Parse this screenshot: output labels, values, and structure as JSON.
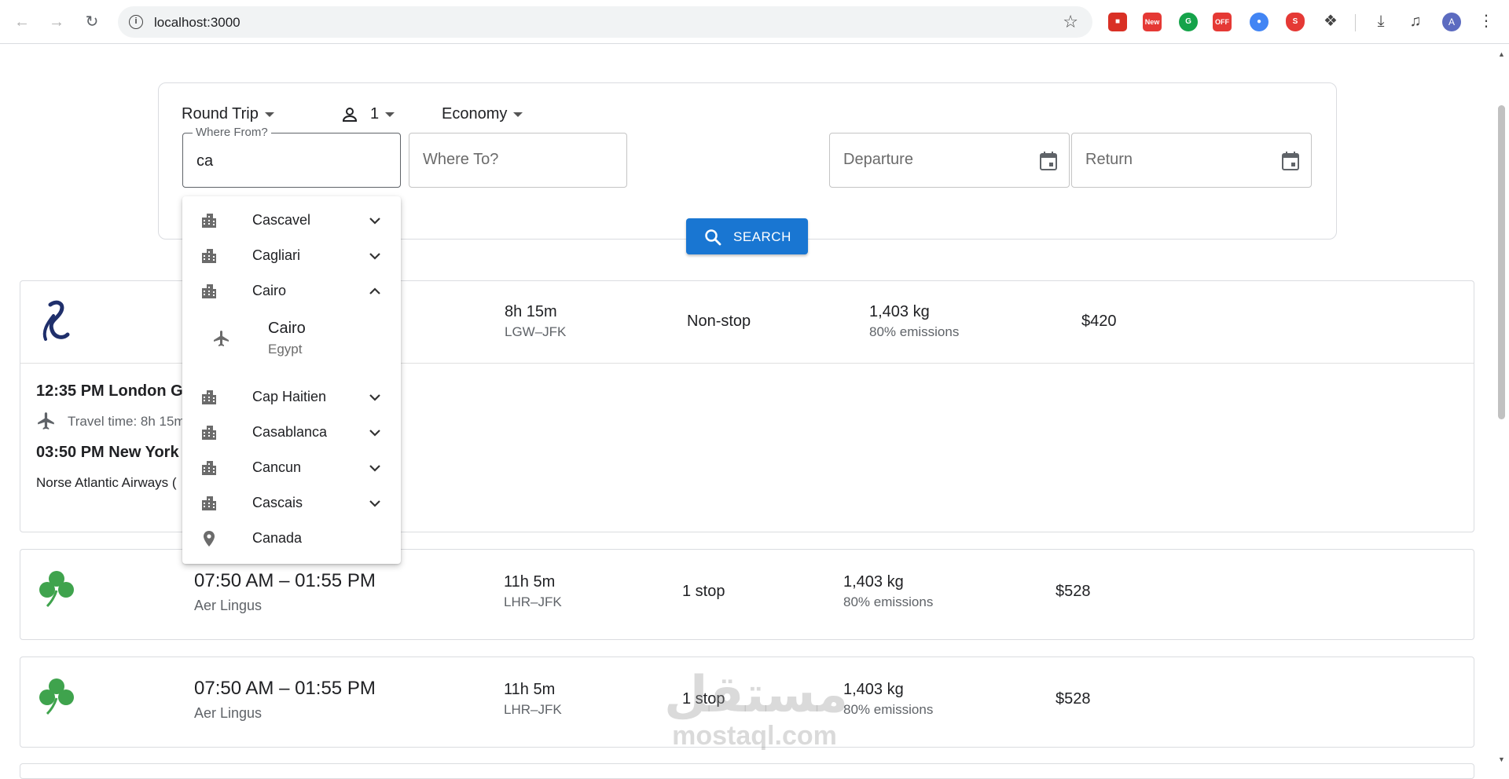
{
  "browser": {
    "url": "localhost:3000",
    "profile_initial": "A",
    "extensions": [
      "extension-1",
      "extension-new",
      "grammarly",
      "extension-off",
      "extension-blue",
      "extension-s",
      "extensions-puzzle"
    ],
    "new_badge": "New",
    "off_badge": "OFF"
  },
  "search": {
    "trip_type": "Round Trip",
    "passengers": "1",
    "cabin_class": "Economy",
    "from_label": "Where From?",
    "from_value": "ca",
    "to_placeholder": "Where To?",
    "departure_placeholder": "Departure",
    "return_placeholder": "Return",
    "search_button": "SEARCH",
    "accent_color": "#1976d2"
  },
  "dropdown": {
    "items": [
      {
        "name": "Cascavel",
        "type": "city",
        "expanded": false
      },
      {
        "name": "Cagliari",
        "type": "city",
        "expanded": false
      },
      {
        "name": "Cairo",
        "type": "city",
        "expanded": true
      },
      {
        "name": "Cap Haitien",
        "type": "city",
        "expanded": false
      },
      {
        "name": "Casablanca",
        "type": "city",
        "expanded": false
      },
      {
        "name": "Cancun",
        "type": "city",
        "expanded": false
      },
      {
        "name": "Cascais",
        "type": "city",
        "expanded": false
      },
      {
        "name": "Canada",
        "type": "country"
      }
    ],
    "airport": {
      "name": "Cairo",
      "country": "Egypt"
    }
  },
  "results": [
    {
      "airline_logo": "norse-logo",
      "duration": "8h 15m",
      "route": "LGW–JFK",
      "stops": "Non-stop",
      "emissions": "1,403 kg",
      "emissions_pct": "80% emissions",
      "price": "$420",
      "expanded": true,
      "details": {
        "departure": "12:35 PM London G",
        "travel_time": "Travel time: 8h 15m",
        "arrival": "03:50 PM New York",
        "carrier": "Norse Atlantic Airways ("
      }
    },
    {
      "airline_logo": "shamrock-logo",
      "times": "07:50 AM – 01:55 PM",
      "airline": "Aer Lingus",
      "duration": "11h 5m",
      "route": "LHR–JFK",
      "stops": "1 stop",
      "emissions": "1,403 kg",
      "emissions_pct": "80% emissions",
      "price": "$528"
    },
    {
      "airline_logo": "shamrock-logo",
      "times": "07:50 AM – 01:55 PM",
      "airline": "Aer Lingus",
      "duration": "11h 5m",
      "route": "LHR–JFK",
      "stops": "1 stop",
      "emissions": "1,403 kg",
      "emissions_pct": "80% emissions",
      "price": "$528"
    }
  ],
  "watermark": {
    "arabic": "مستقل",
    "latin": "mostaql.com"
  }
}
